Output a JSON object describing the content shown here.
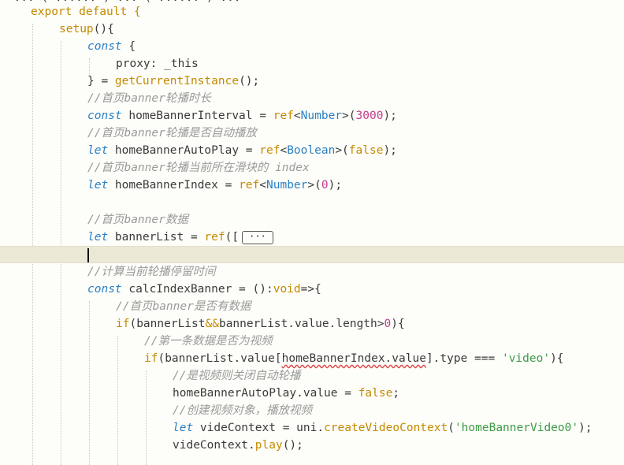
{
  "editor": {
    "top_cut_text": "  ... ( ...... ) ... ( ...... ) ...",
    "lines": [
      {
        "k": "l0",
        "indent": 0
      },
      {
        "k": "l1",
        "indent": 1
      },
      {
        "k": "l2",
        "indent": 2
      },
      {
        "k": "l3",
        "indent": 3
      },
      {
        "k": "l4",
        "indent": 2
      },
      {
        "k": "l5",
        "indent": 2
      },
      {
        "k": "l6",
        "indent": 2
      },
      {
        "k": "l7",
        "indent": 2
      },
      {
        "k": "l8",
        "indent": 2
      },
      {
        "k": "l9",
        "indent": 2
      },
      {
        "k": "l10",
        "indent": 2
      }
    ],
    "code": {
      "l0": [
        "export default {"
      ],
      "l1": [
        "setup",
        "(){"
      ],
      "l2": [
        "const",
        " {"
      ],
      "l3": [
        "proxy: _this"
      ],
      "l4": [
        "} = ",
        "getCurrentInstance",
        "();"
      ],
      "l5": [
        "//首页banner轮播时长"
      ],
      "l6": [
        "const",
        " homeBannerInterval = ",
        "ref",
        "<",
        "Number",
        ">(",
        "3000",
        ");"
      ],
      "l7": [
        "//首页banner轮播是否自动播放"
      ],
      "l8": [
        "let",
        " homeBannerAutoPlay = ",
        "ref",
        "<",
        "Boolean",
        ">(",
        "false",
        ");"
      ],
      "l9": [
        "//首页banner轮播当前所在滑块的 index"
      ],
      "l10": [
        "let",
        " homeBannerIndex = ",
        "ref",
        "<",
        "Number",
        ">(",
        "0",
        ");"
      ],
      "l11": [
        ""
      ],
      "l12": [
        "//首页banner数据"
      ],
      "l13": [
        "let",
        " bannerList = ",
        "ref",
        "([",
        "···"
      ],
      "l14": [
        ""
      ],
      "l15": [
        ""
      ],
      "l16": [
        "//计算当前轮播停留时间"
      ],
      "l17": [
        "const",
        " calcIndexBanner = ():",
        "void",
        "=>{"
      ],
      "l18": [
        "//首页banner是否有数据"
      ],
      "l19": [
        "if",
        "(bannerList",
        "&&",
        "bannerList.value.length>",
        "0",
        "){"
      ],
      "l20": [
        "//第一条数据是否为视频"
      ],
      "l21": [
        "if",
        "(bannerList.value[",
        "homeBannerIndex.value",
        "].type === ",
        "'video'",
        "){"
      ],
      "l22": [
        "//是视频则关闭自动轮播"
      ],
      "l23": [
        "homeBannerAutoPlay.value = ",
        "false",
        ";"
      ],
      "l24": [
        "//创建视频对象，播放视频"
      ],
      "l25": [
        "let",
        " videContext = uni.",
        "createVideoContext",
        "(",
        "'homeBannerVideo0'",
        ");"
      ],
      "l26": [
        "videContext.",
        "play",
        "();"
      ]
    }
  }
}
